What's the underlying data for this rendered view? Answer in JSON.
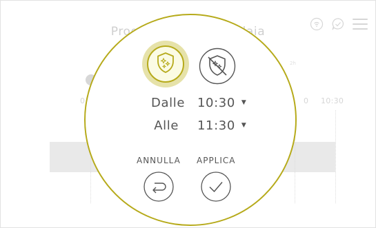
{
  "background": {
    "title": "Programmazione caldaia",
    "timeline_labels": [
      "0",
      "0",
      "10:30"
    ],
    "minor_label": "2h"
  },
  "dialog": {
    "mode_active_icon": "shield-sparkle-icon",
    "mode_inactive_icon": "shield-sparkle-crossed-icon",
    "from_label": "Dalle",
    "from_time": "10:30",
    "to_label": "Alle",
    "to_time": "11:30",
    "cancel_label": "ANNULLA",
    "apply_label": "APPLICA"
  },
  "colors": {
    "accent": "#b6aa1a",
    "accent_fill": "#e6e2a9",
    "text": "#555555",
    "muted": "#cfcfcf"
  }
}
